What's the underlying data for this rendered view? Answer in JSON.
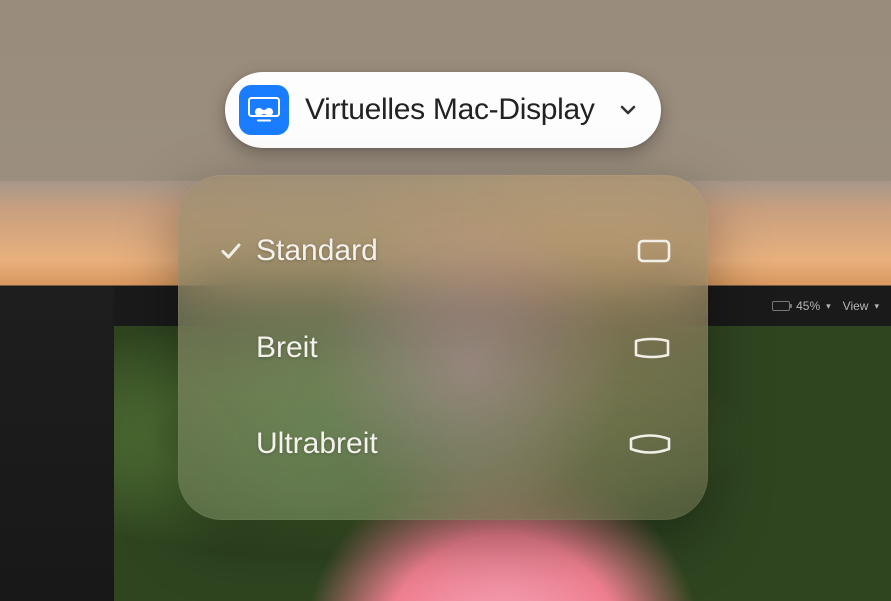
{
  "colors": {
    "accent": "#1a7dff"
  },
  "toolbar": {
    "zoom_label": "45%",
    "view_label": "View"
  },
  "pill": {
    "icon": "vision-pro-display-icon",
    "label": "Virtuelles Mac-Display"
  },
  "popover": {
    "options": [
      {
        "id": "standard",
        "label": "Standard",
        "selected": true,
        "icon": "ratio-standard-icon"
      },
      {
        "id": "wide",
        "label": "Breit",
        "selected": false,
        "icon": "ratio-wide-icon"
      },
      {
        "id": "ultrawide",
        "label": "Ultrabreit",
        "selected": false,
        "icon": "ratio-ultrawide-icon"
      }
    ]
  }
}
